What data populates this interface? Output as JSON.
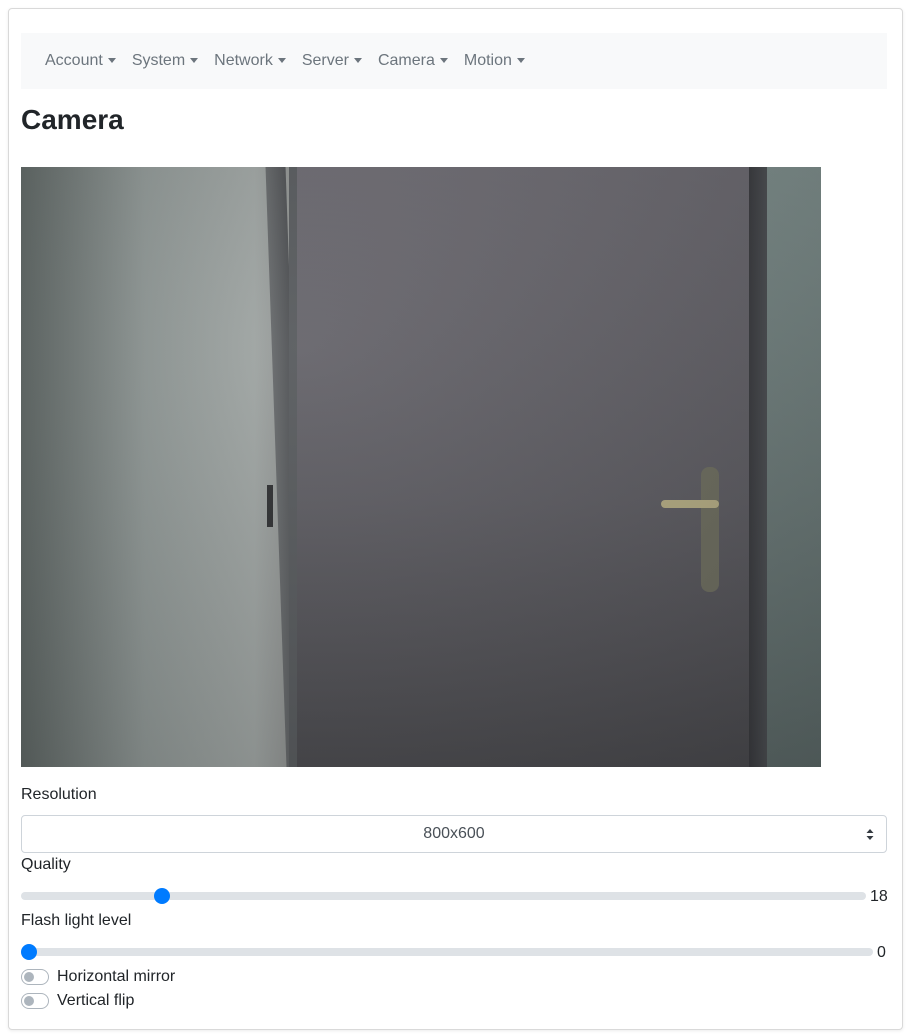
{
  "nav": {
    "items": [
      {
        "label": "Account"
      },
      {
        "label": "System"
      },
      {
        "label": "Network"
      },
      {
        "label": "Server"
      },
      {
        "label": "Camera"
      },
      {
        "label": "Motion"
      }
    ]
  },
  "page": {
    "title": "Camera"
  },
  "camera": {
    "stream": "camera-stream-image"
  },
  "resolution": {
    "label": "Resolution",
    "value": "800x600"
  },
  "quality": {
    "label": "Quality",
    "value": "18",
    "level": 0.16
  },
  "flash": {
    "label": "Flash light level",
    "value": "0",
    "level": 0
  },
  "toggles": {
    "hmirror": {
      "label": "Horizontal mirror",
      "on": false
    },
    "vflip": {
      "label": "Vertical flip",
      "on": false
    }
  },
  "colors": {
    "accent": "#007bff",
    "navbar_bg": "#f8f9fa",
    "nav_text": "#6c757d"
  }
}
